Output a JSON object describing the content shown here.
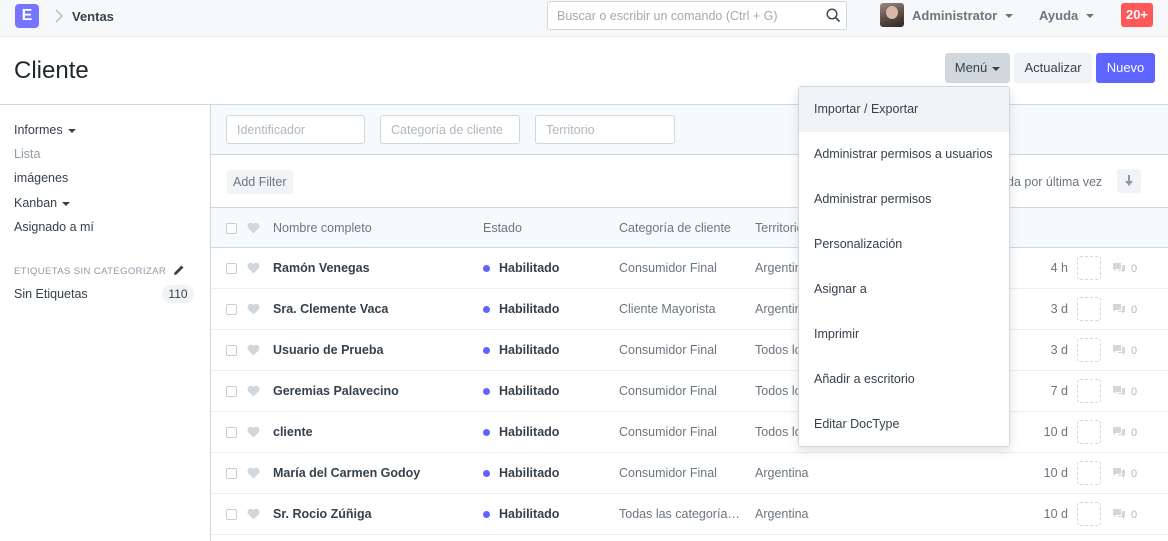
{
  "navbar": {
    "logo_letter": "E",
    "breadcrumb": "Ventas",
    "search_placeholder": "Buscar o escribir un comando (Ctrl + G)",
    "user_name": "Administrator",
    "help_label": "Ayuda",
    "notifications": "20+"
  },
  "page": {
    "title": "Cliente",
    "menu_button": "Menú",
    "refresh_button": "Actualizar",
    "new_button": "Nuevo"
  },
  "sidebar": {
    "items": [
      "Informes",
      "Lista",
      "imágenes",
      "Kanban",
      "Asignado a mí"
    ],
    "section_title": "ETIQUETAS SIN CATEGORIZAR",
    "tag_label": "Sin Etiquetas",
    "tag_count": "110"
  },
  "filters": {
    "id_placeholder": "Identificador",
    "category_placeholder": "Categoría de cliente",
    "territory_placeholder": "Territorio",
    "add_filter": "Add Filter",
    "sort_label": "da por última vez"
  },
  "list": {
    "columns": [
      "Nombre completo",
      "Estado",
      "Categoría de cliente",
      "Territorio"
    ],
    "rows": [
      {
        "name": "Ramón Venegas",
        "status": "Habilitado",
        "category": "Consumidor Final",
        "territory": "Argentina",
        "time": "4 h",
        "comments": "0"
      },
      {
        "name": "Sra. Clemente Vaca",
        "status": "Habilitado",
        "category": "Cliente Mayorista",
        "territory": "Argentina",
        "time": "3 d",
        "comments": "0"
      },
      {
        "name": "Usuario de Prueba",
        "status": "Habilitado",
        "category": "Consumidor Final",
        "territory": "Todos los",
        "time": "3 d",
        "comments": "0"
      },
      {
        "name": "Geremias Palavecino",
        "status": "Habilitado",
        "category": "Consumidor Final",
        "territory": "Todos los",
        "time": "7 d",
        "comments": "0"
      },
      {
        "name": "cliente",
        "status": "Habilitado",
        "category": "Consumidor Final",
        "territory": "Todos los",
        "time": "10 d",
        "comments": "0"
      },
      {
        "name": "María del Carmen Godoy",
        "status": "Habilitado",
        "category": "Consumidor Final",
        "territory": "Argentina",
        "time": "10 d",
        "comments": "0"
      },
      {
        "name": "Sr. Rocio Zúñiga",
        "status": "Habilitado",
        "category": "Todas las categoría…",
        "territory": "Argentina",
        "time": "10 d",
        "comments": "0"
      }
    ]
  },
  "menu_dropdown": {
    "items": [
      "Importar / Exportar",
      "Administrar permisos a usuarios",
      "Administrar permisos",
      "Personalización",
      "Asignar a",
      "Imprimir",
      "Añadir a escritorio",
      "Editar DocType"
    ]
  },
  "colors": {
    "accent": "#5e64ff",
    "notification": "#ff5858",
    "logo": "#7575ff"
  }
}
